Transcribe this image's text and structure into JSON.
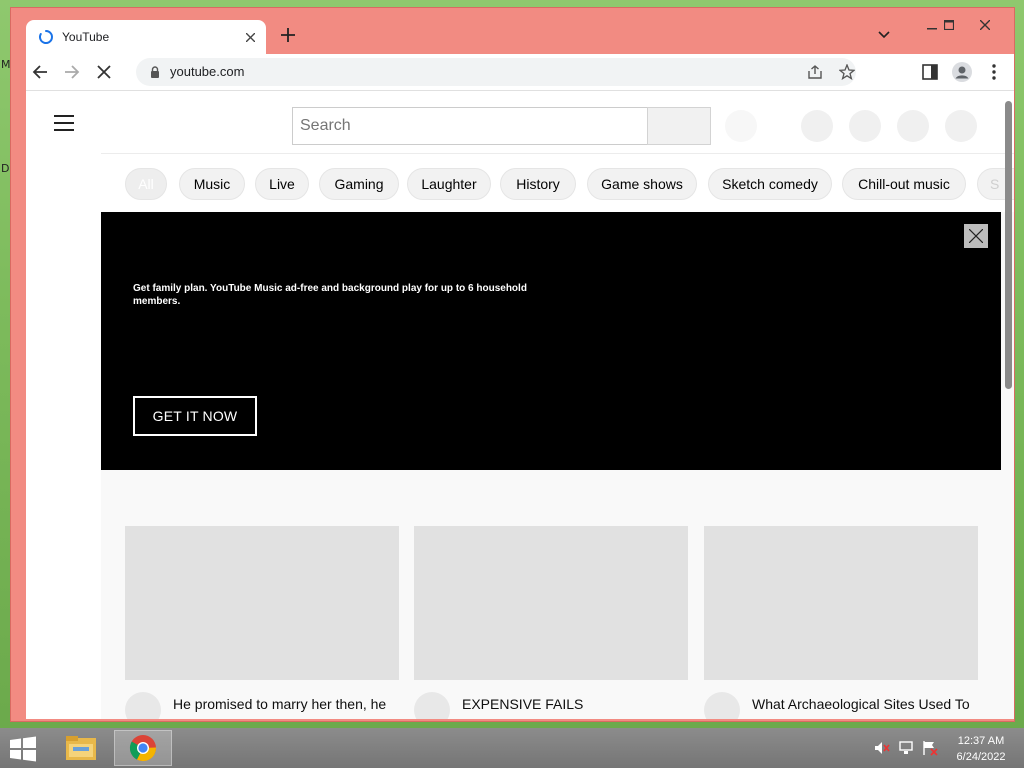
{
  "desktop": {
    "edge_label_top": "M",
    "edge_label_mid": "D"
  },
  "browser": {
    "tab": {
      "title": "YouTube"
    },
    "url": "youtube.com",
    "accent": "#1a73e8",
    "frame_color": "#f28b82"
  },
  "youtube": {
    "search_placeholder": "Search",
    "chips": [
      "All",
      "Music",
      "Live",
      "Gaming",
      "Laughter",
      "History",
      "Game shows",
      "Sketch comedy",
      "Chill-out music",
      "S"
    ],
    "promo": {
      "text": "Get family plan. YouTube Music ad-free and background play for up to 6 household members.",
      "cta": "GET IT NOW"
    },
    "videos": [
      {
        "title": "He promised to marry her then, he had the other dr... hnd r..."
      },
      {
        "title": "EXPENSIVE FAILS"
      },
      {
        "title": "What Archaeological Sites Used To Look Like Whe..."
      }
    ]
  },
  "taskbar": {
    "apps": [
      "file-explorer",
      "chrome"
    ],
    "time": "12:37 AM",
    "date": "6/24/2022"
  }
}
